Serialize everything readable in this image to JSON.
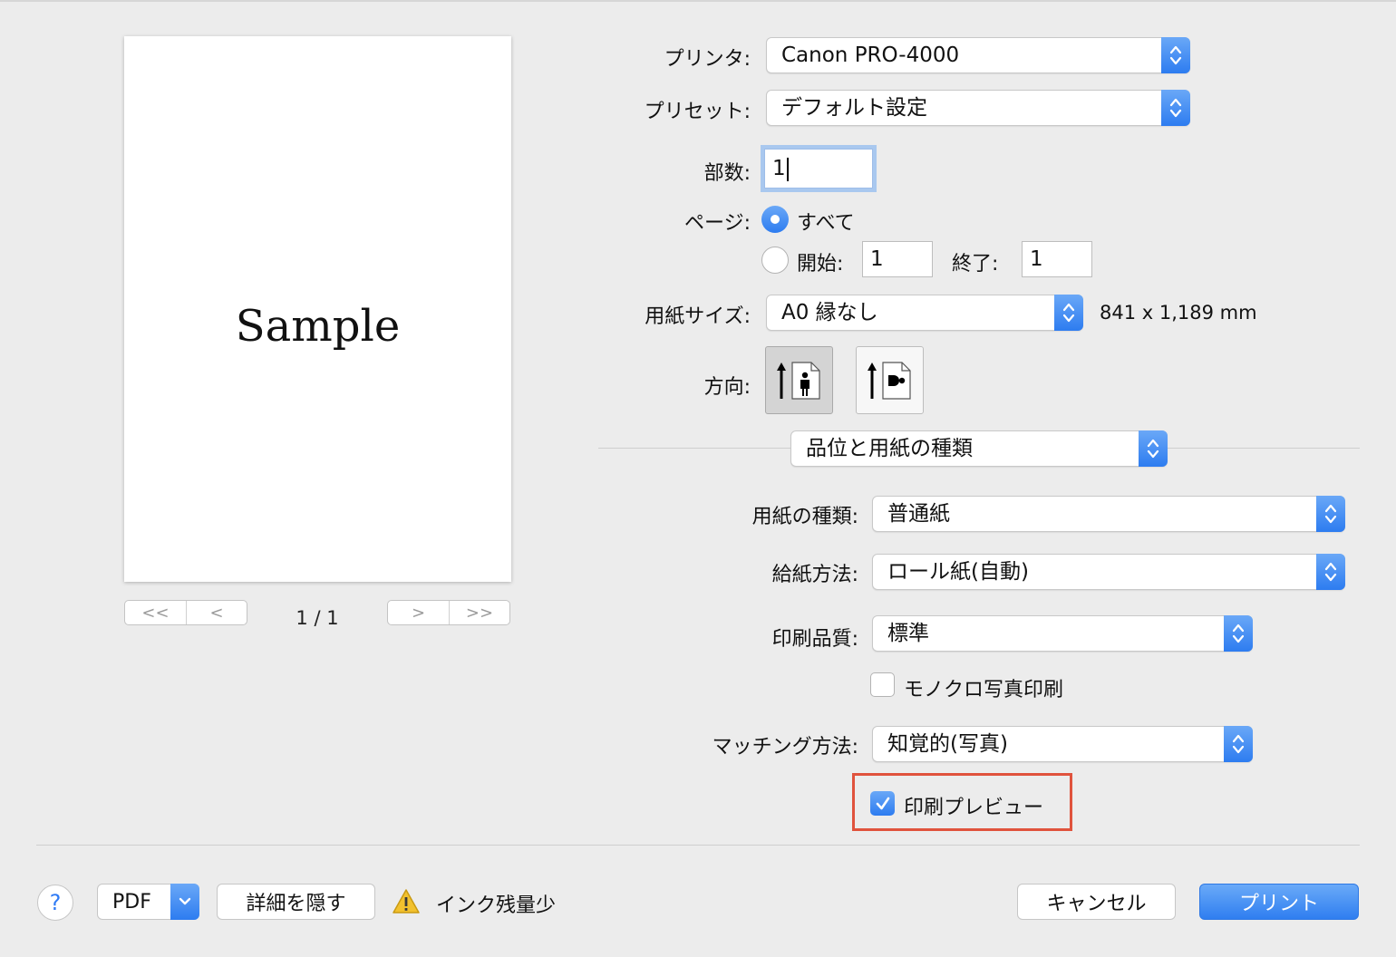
{
  "preview": {
    "sample_text": "Sample",
    "page_counter": "1 / 1",
    "nav": {
      "first": "<<",
      "prev": "<",
      "next": ">",
      "last": ">>"
    }
  },
  "printer": {
    "label": "プリンタ:",
    "value": "Canon PRO-4000"
  },
  "preset": {
    "label": "プリセット:",
    "value": "デフォルト設定"
  },
  "copies": {
    "label": "部数:",
    "value": "1"
  },
  "pages": {
    "label": "ページ:",
    "all_label": "すべて",
    "from_label": "開始:",
    "from_value": "1",
    "to_label": "終了:",
    "to_value": "1",
    "selected": "all"
  },
  "paper_size": {
    "label": "用紙サイズ:",
    "value": "A0 縁なし",
    "dimensions": "841 x 1,189 mm"
  },
  "orientation": {
    "label": "方向:",
    "selected": "portrait"
  },
  "section": {
    "value": "品位と用紙の種類"
  },
  "media_type": {
    "label": "用紙の種類:",
    "value": "普通紙"
  },
  "paper_source": {
    "label": "給紙方法:",
    "value": "ロール紙(自動)"
  },
  "print_quality": {
    "label": "印刷品質:",
    "value": "標準"
  },
  "mono_photo": {
    "label": "モノクロ写真印刷",
    "checked": false
  },
  "matching": {
    "label": "マッチング方法:",
    "value": "知覚的(写真)"
  },
  "print_preview": {
    "label": "印刷プレビュー",
    "checked": true
  },
  "footer": {
    "help": "?",
    "pdf": "PDF",
    "hide_details": "詳細を隠す",
    "warning": "インク残量少",
    "cancel": "キャンセル",
    "print": "プリント"
  },
  "colors": {
    "accent": "#2f7ef0",
    "highlight": "#e0533d",
    "background": "#ececec"
  }
}
